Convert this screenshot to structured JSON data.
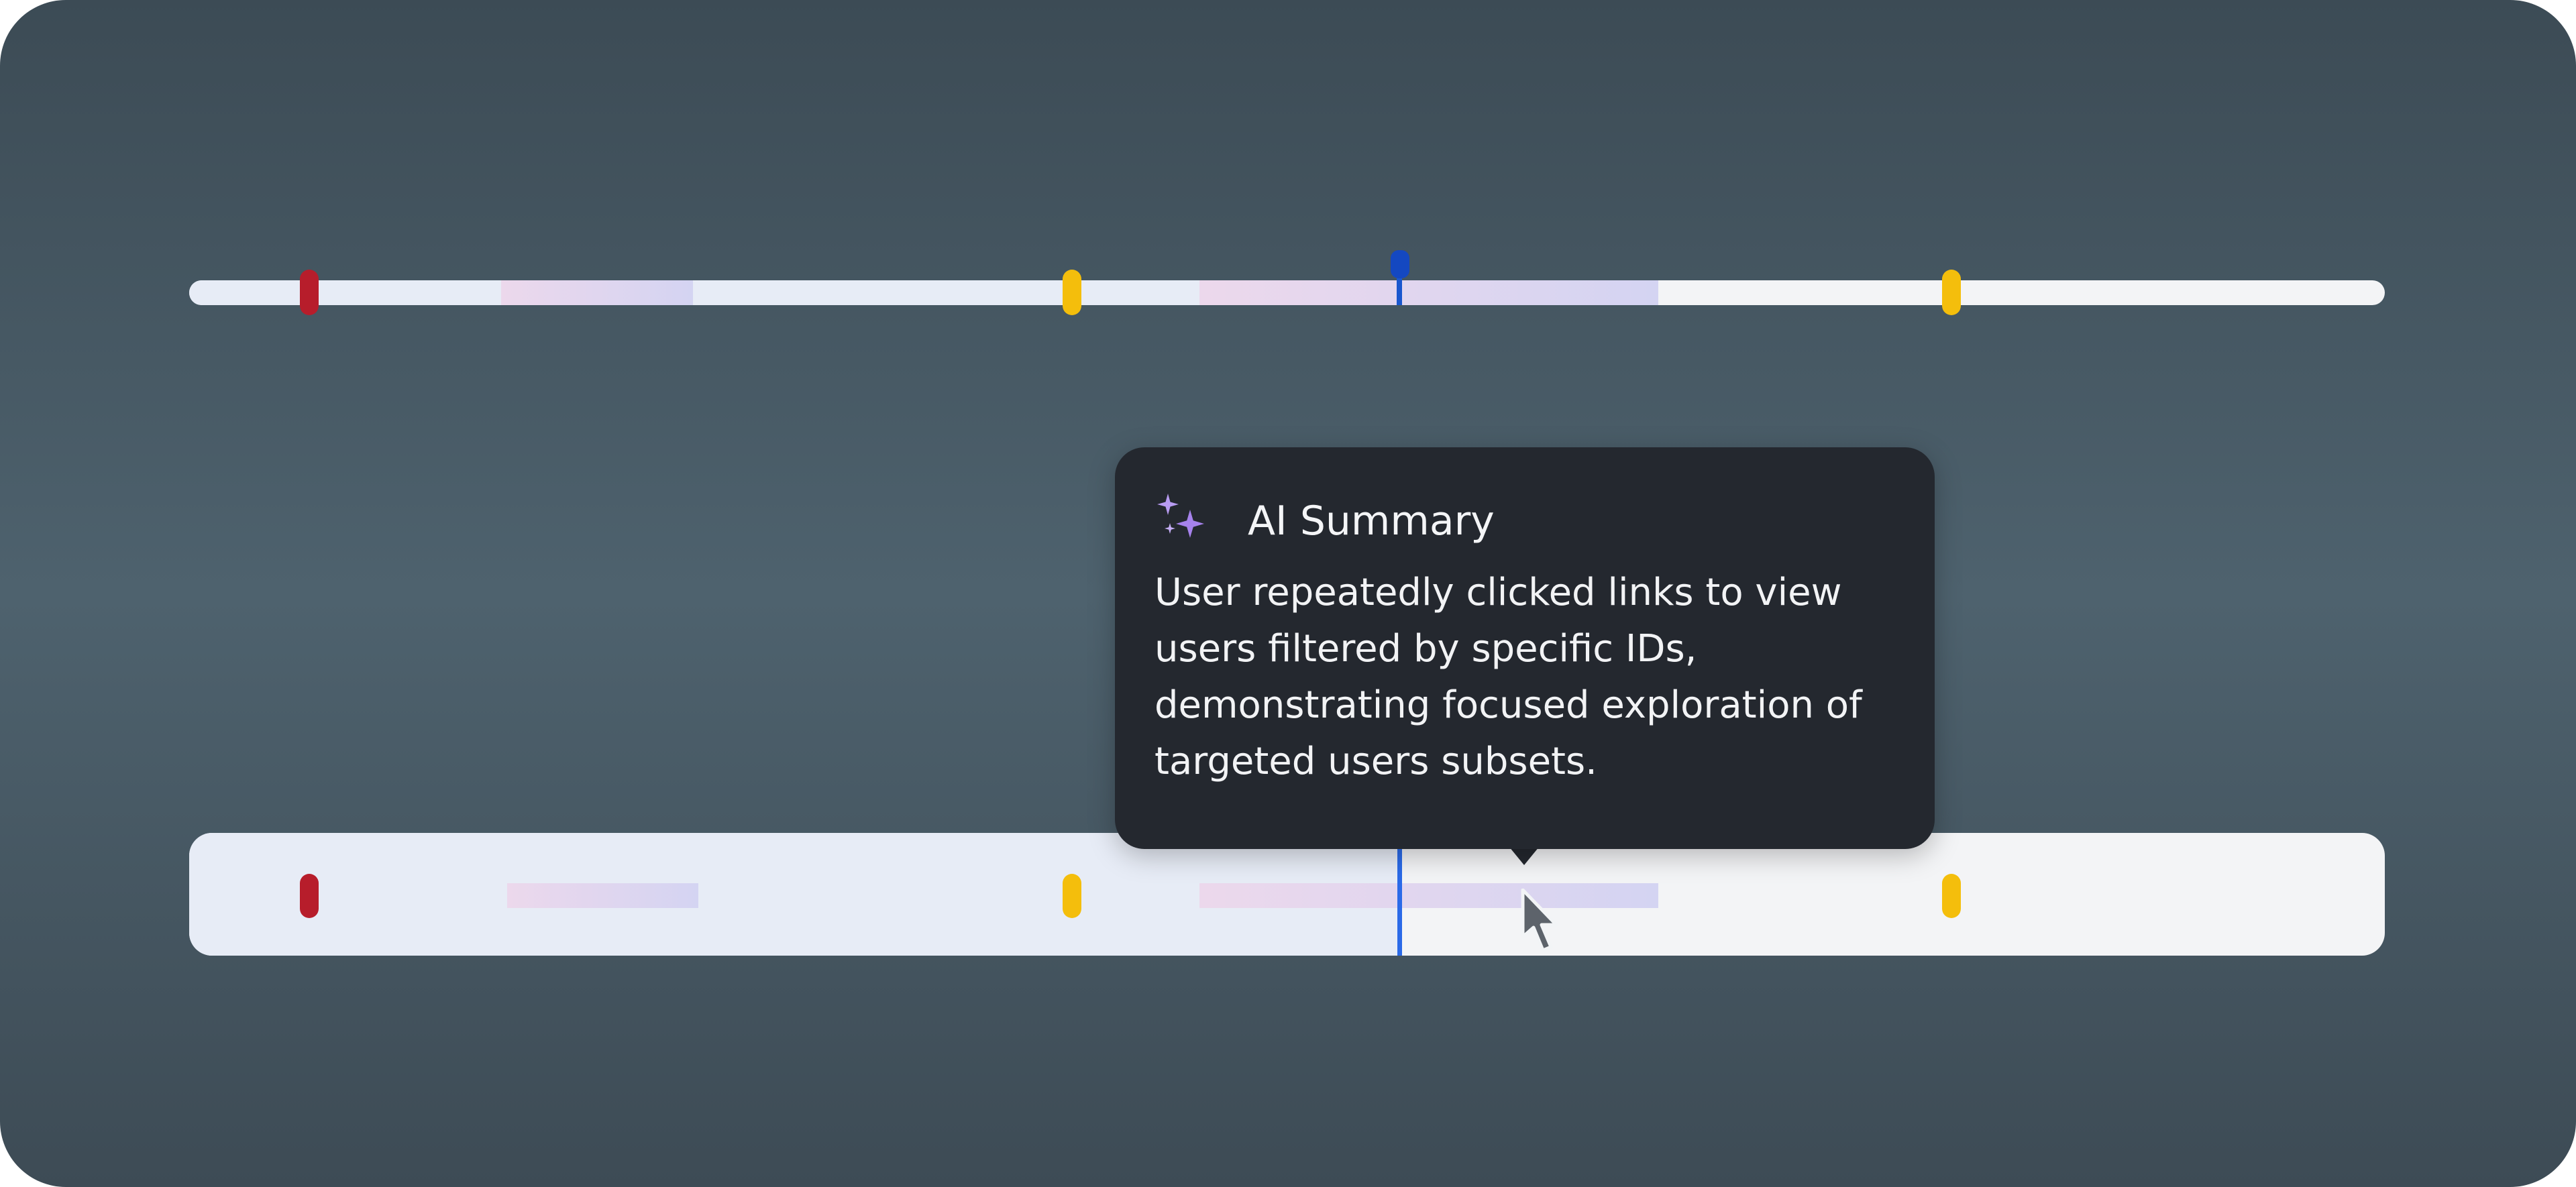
{
  "tooltip": {
    "icon": "sparkles-icon",
    "title": "AI Summary",
    "body": "User repeatedly clicked links to view users filtered by specific IDs, demonstrating focused exploration of targeted users subsets."
  },
  "timeline": {
    "marker_colors": {
      "error": "#b71d2b",
      "warning": "#f4be0c",
      "playhead": "#1a57ce"
    },
    "segment_gradient": [
      "#ecd8ec",
      "#d4d4f2"
    ],
    "played_color": "#e7ecf6",
    "unplayed_color": "#f3f4f6"
  },
  "cursor": {
    "icon": "pointer-cursor-icon"
  }
}
